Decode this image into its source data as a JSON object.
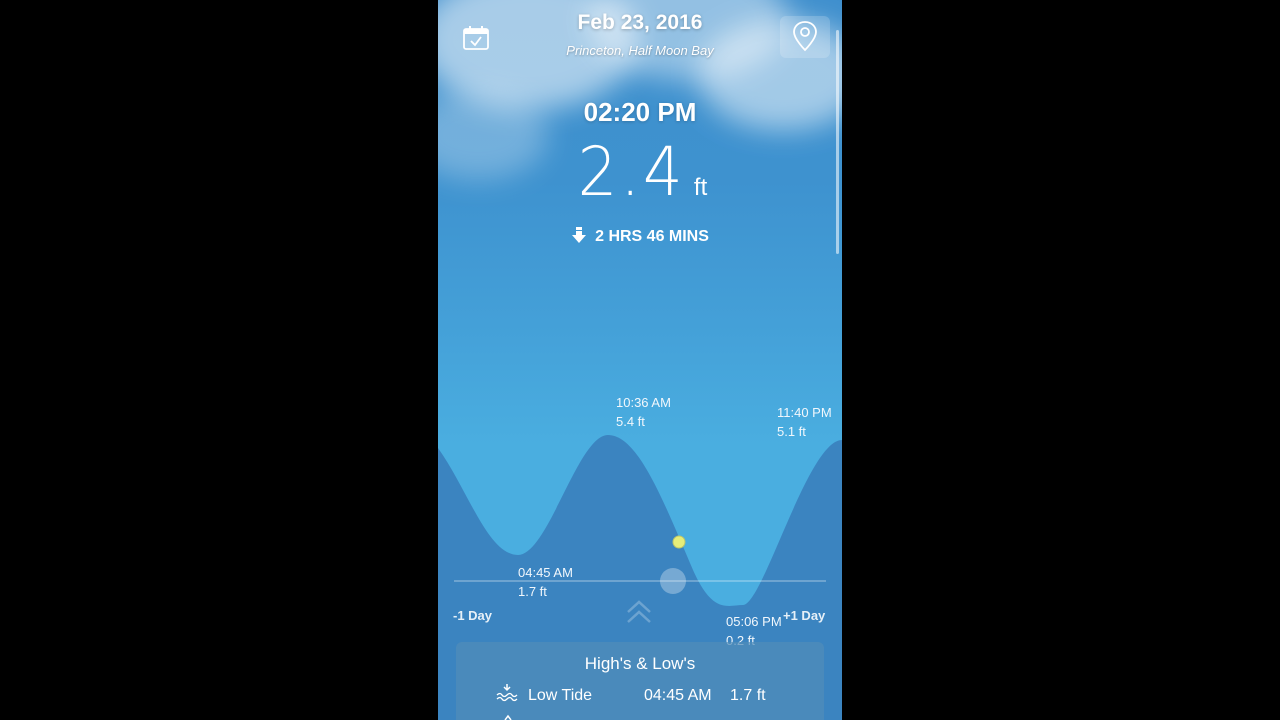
{
  "header": {
    "date": "Feb 23, 2016",
    "location": "Princeton, Half Moon Bay",
    "calendar_icon": "calendar-icon",
    "location_icon": "map-pin-icon"
  },
  "current": {
    "time": "02:20 PM",
    "height_value": "2.4",
    "height_unit": "ft",
    "trend_icon": "arrow-down-icon",
    "countdown": "2 HRS 46 MINS"
  },
  "chart": {
    "high1_time": "10:36 AM",
    "high1_height": "5.4 ft",
    "high2_time": "11:40 PM",
    "high2_height": "5.1 ft",
    "low1_time": "04:45 AM",
    "low1_height": "1.7 ft",
    "low2_time": "05:06 PM",
    "low2_height": "0.2 ft",
    "prev_day": "-1 Day",
    "next_day": "+1 Day",
    "expand_icon": "double-chevron-up-icon",
    "colors": {
      "wave": "#3b84c0",
      "current_dot": "#e6ee7a"
    }
  },
  "panel": {
    "title": "High's & Low's",
    "rows": [
      {
        "icon": "low-tide-icon",
        "label": "Low Tide",
        "time": "04:45 AM",
        "height": "1.7 ft"
      }
    ]
  }
}
